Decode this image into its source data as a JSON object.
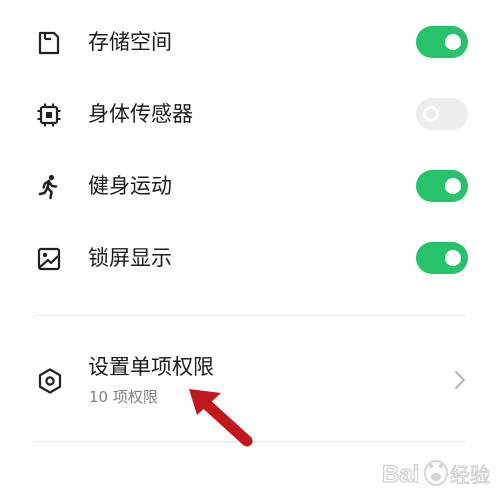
{
  "permissions": [
    {
      "label": "存储空间",
      "icon": "storage-icon",
      "enabled": true
    },
    {
      "label": "身体传感器",
      "icon": "chip-sensor-icon",
      "enabled": false
    },
    {
      "label": "健身运动",
      "icon": "running-person-icon",
      "enabled": true
    },
    {
      "label": "锁屏显示",
      "icon": "lockscreen-image-icon",
      "enabled": true
    }
  ],
  "single_permission": {
    "title": "设置单项权限",
    "subtitle": "10 项权限",
    "icon": "hexagon-settings-icon"
  },
  "colors": {
    "toggle_on": "#27c36a",
    "toggle_off": "#eeeeee",
    "annotation_arrow": "#c0181c"
  },
  "watermark": {
    "text": "Bai经验"
  }
}
